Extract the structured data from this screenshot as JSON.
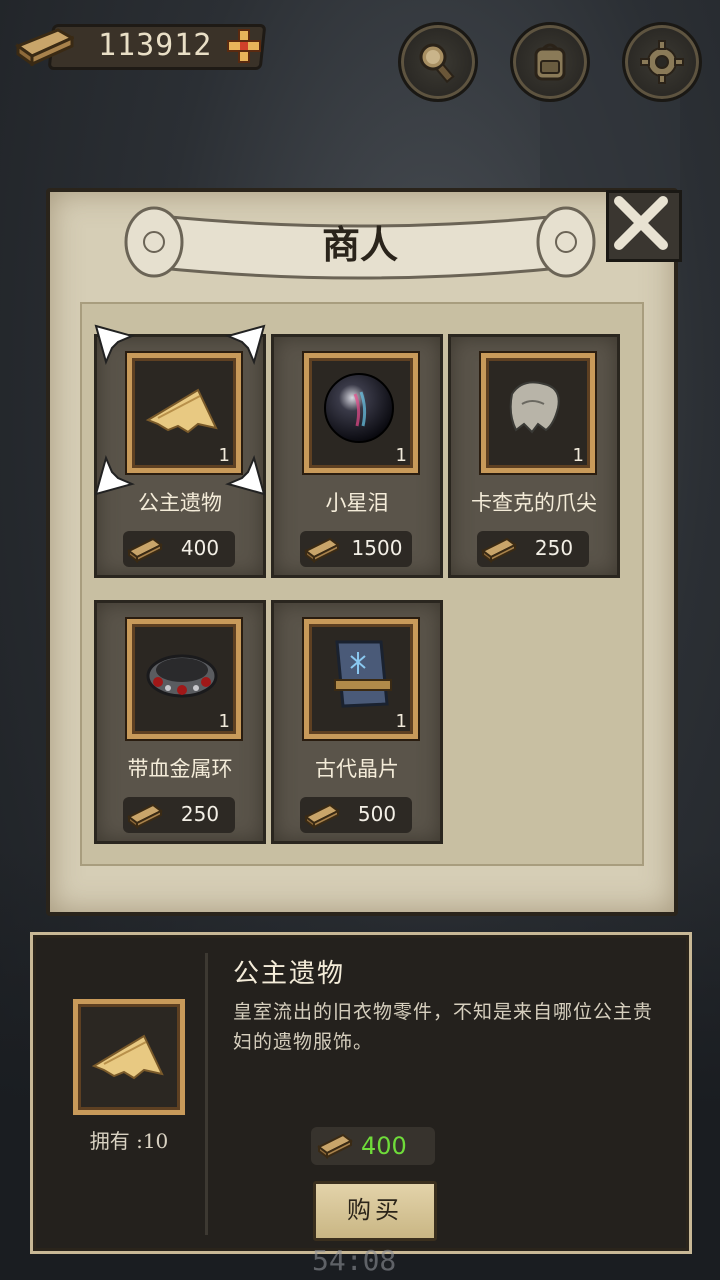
{
  "top_bar": {
    "wood_count": "113912",
    "buttons": [
      {
        "icon": "magnifier-tools-icon"
      },
      {
        "icon": "backpack-icon"
      },
      {
        "icon": "gear-icon"
      }
    ]
  },
  "merchant": {
    "title": "商人",
    "items": [
      {
        "name": "公主遗物",
        "qty": "1",
        "price": "400",
        "icon": "cloth-scrap-icon",
        "selected": true
      },
      {
        "name": "小星泪",
        "qty": "1",
        "price": "1500",
        "icon": "star-orb-icon"
      },
      {
        "name": "卡查克的爪尖",
        "qty": "1",
        "price": "250",
        "icon": "claw-icon"
      },
      {
        "name": "带血金属环",
        "qty": "1",
        "price": "250",
        "icon": "bloody-ring-icon"
      },
      {
        "name": "古代晶片",
        "qty": "1",
        "price": "500",
        "icon": "crystal-shard-icon"
      }
    ]
  },
  "detail": {
    "name": "公主遗物",
    "description": "皇室流出的旧衣物零件，不知是来自哪位公主贵妇的遗物服饰。",
    "owned_label": "拥有 :10",
    "price": "400",
    "buy_label": "购买",
    "price_color": "#6fdc3a"
  },
  "timer": "54:08"
}
